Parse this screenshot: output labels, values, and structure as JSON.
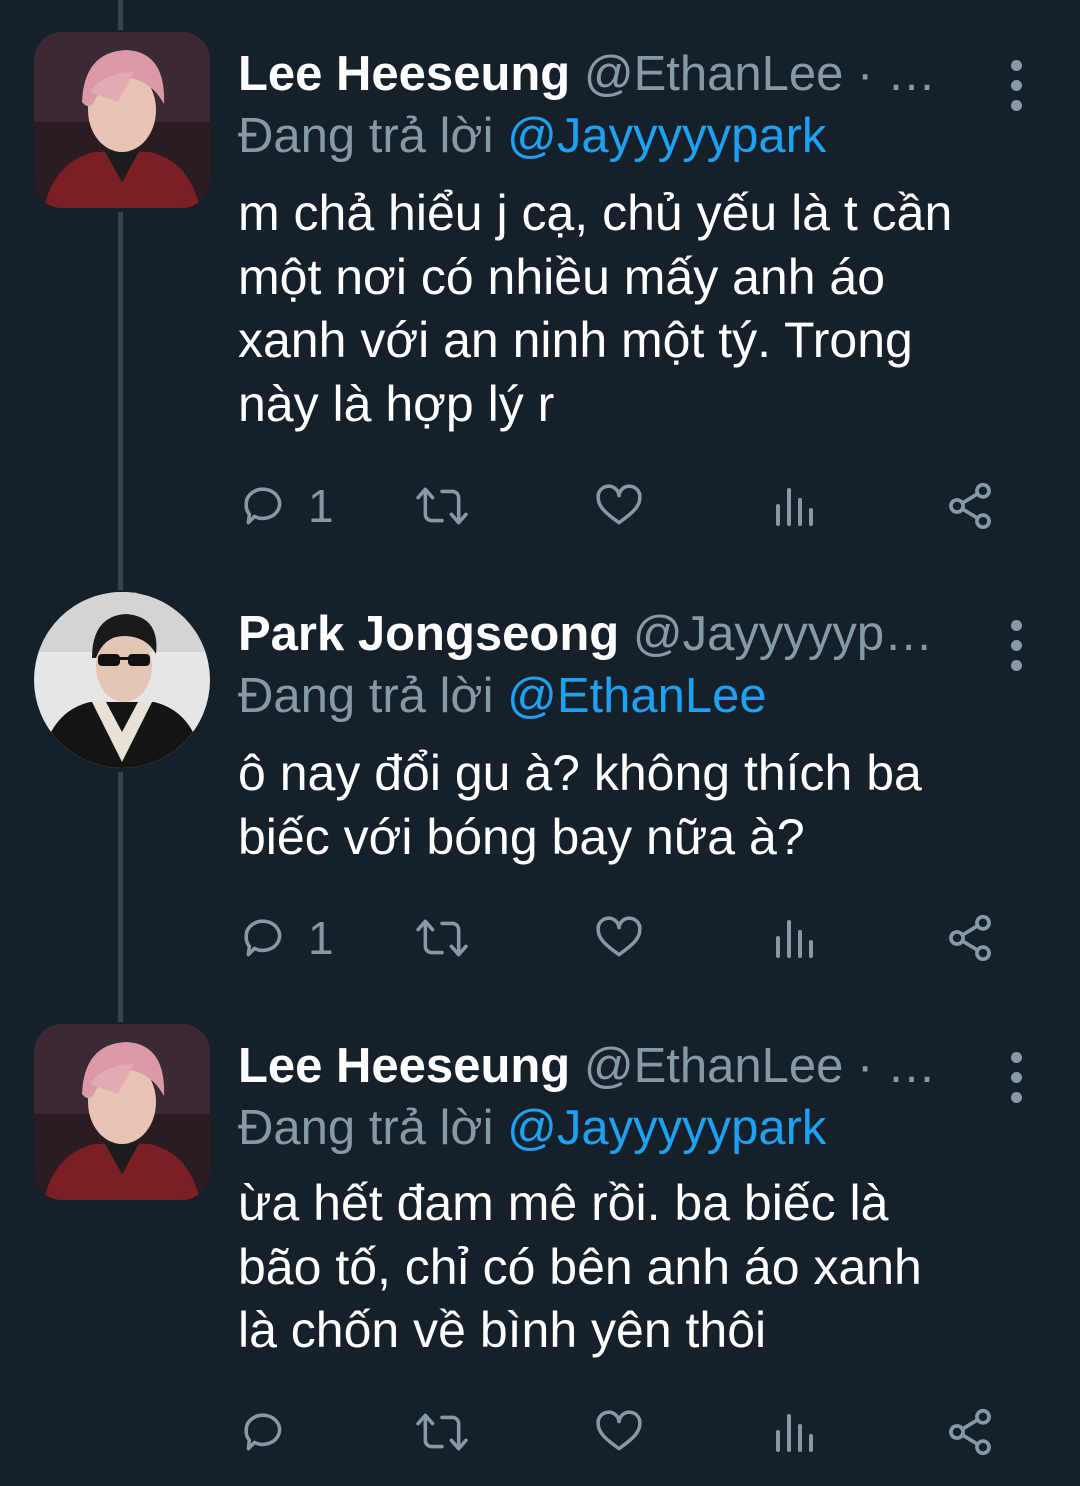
{
  "colors": {
    "background": "#15202b",
    "text": "#ffffff",
    "secondary": "#8899a6",
    "mention": "#1da1f2",
    "thread_line": "#38444d"
  },
  "tweets": [
    {
      "name": "Lee Heeseung",
      "handle": "@EthanLee",
      "separator": "· …",
      "replying_prefix": "Đang trả lời",
      "replying_to": "@Jayyyyypark",
      "text": "m chả hiểu j cạ, chủ yếu là t cần\nmột nơi có nhiều mấy anh áo\nxanh với an ninh một tý. Trong\nnày là hợp lý r",
      "reply_count": "1",
      "avatar_icon": "pink-hair-profile-avatar"
    },
    {
      "name": "Park Jongseong",
      "handle": "@Jayyyyyp…",
      "separator": "",
      "replying_prefix": "Đang trả lời",
      "replying_to": "@EthanLee",
      "text": "ô nay đổi gu à? không thích ba\nbiếc với bóng bay nữa à?",
      "reply_count": "1",
      "avatar_icon": "sunglasses-profile-avatar"
    },
    {
      "name": "Lee Heeseung",
      "handle": "@EthanLee",
      "separator": "· …",
      "replying_prefix": "Đang trả lời",
      "replying_to": "@Jayyyyypark",
      "text": "ừa hết đam mê rồi. ba biếc là\nbão tố, chỉ có bên anh áo xanh\nlà chốn về bình yên thôi",
      "reply_count": "",
      "avatar_icon": "pink-hair-profile-avatar"
    }
  ]
}
